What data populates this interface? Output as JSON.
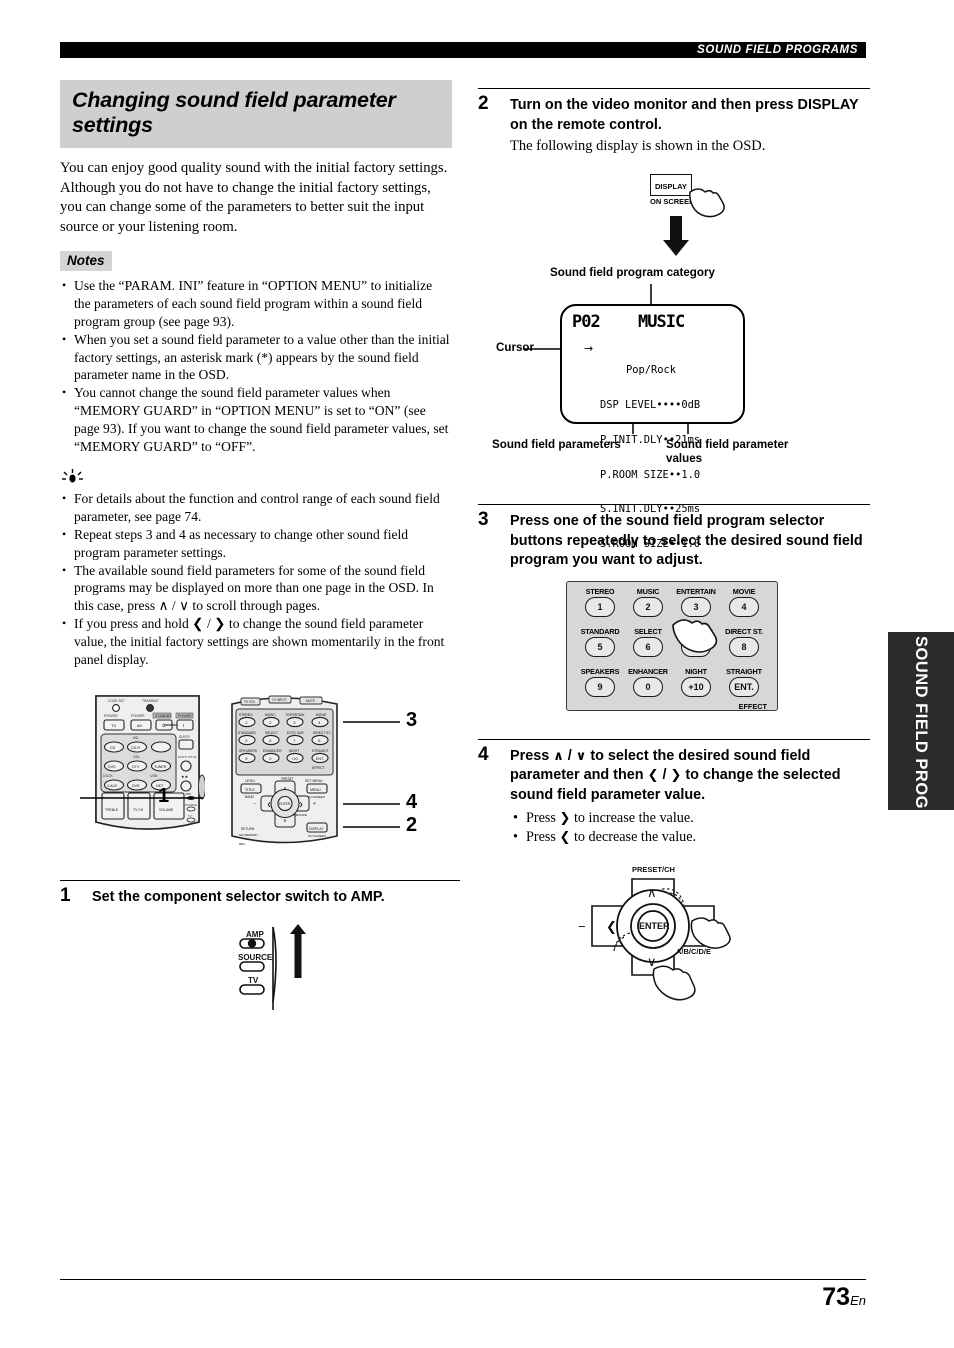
{
  "header": {
    "section_title": "SOUND FIELD PROGRAMS"
  },
  "page": {
    "number": "73",
    "lang_suffix": "En"
  },
  "side_tab": {
    "label": "SOUND FIELD PROGRAMS"
  },
  "title": {
    "text": "Changing sound field parameter settings"
  },
  "intro": {
    "text": "You can enjoy good quality sound with the initial factory settings. Although you do not have to change the initial factory settings, you can change some of the parameters to better suit the input source or your listening room."
  },
  "notes": {
    "label": "Notes",
    "items": [
      "Use the “PARAM. INI” feature in “OPTION MENU” to initialize the parameters of each sound field program within a sound field program group (see page 93).",
      "When you set a sound field parameter to a value other than the initial factory settings, an asterisk mark (*) appears by the sound field parameter name in the OSD.",
      "You cannot change the sound field parameter values when “MEMORY GUARD” in “OPTION MENU” is set to “ON” (see page 93). If you want to change the sound field parameter values, set “MEMORY GUARD” to “OFF”."
    ]
  },
  "tips": {
    "icon": "tip-bulb-icon",
    "items": [
      "For details about the function and control range of each sound field parameter, see page 74.",
      "Repeat steps 3 and 4 as necessary to change other sound field program parameter settings.",
      "The available sound field parameters for some of the sound field programs may be displayed on more than one page in the OSD. In this case, press ∧ / ∨ to scroll through pages.",
      "If you press and hold ❮ / ❯ to change the sound field parameter value, the initial factory settings are shown momentarily in the front panel display."
    ]
  },
  "remote_figure": {
    "callouts": [
      "1",
      "3",
      "4",
      "2"
    ],
    "left_remote": {
      "indicator_labels": [
        "CODE SET",
        "TRANSMIT"
      ],
      "power_labels": [
        "POWER",
        "POWER",
        "STANDBY",
        "POWER"
      ],
      "power_buttons": [
        "TV",
        "AV",
        "⏻",
        "I"
      ],
      "sleep_label": "SLEEP",
      "group_labels": [
        "MD",
        "CBL.",
        "DOCK",
        "USB",
        "MULTI CH IN"
      ],
      "source_buttons": [
        "CD",
        "CD-R",
        "DVD",
        "DTV",
        "TUNER",
        "V.AUX",
        "DVR",
        "NET"
      ],
      "bottom_labels": [
        "TREBLE",
        "TV CH",
        "VOLUME"
      ],
      "switch_labels": [
        "AMP",
        "SOURCE",
        "TV"
      ]
    },
    "right_remote": {
      "top_buttons": [
        "TV VOL",
        "TV INPUT",
        "MUTE"
      ],
      "program_captions": [
        "STEREO",
        "MUSIC",
        "ENTERTAIN",
        "MOVIE",
        "STANDARD",
        "SELECT",
        "EXTD SUR.",
        "DIRECT ST.",
        "SPEAKERS",
        "ENHANCER",
        "NIGHT",
        "STRAIGHT"
      ],
      "program_keys": [
        "1",
        "2",
        "3",
        "4",
        "5",
        "6",
        "7",
        "8",
        "9",
        "0",
        "+10",
        "ENT."
      ],
      "effect_label": "EFFECT",
      "left_column": [
        "LEVEL",
        "TITLE",
        "BAND",
        "RETURN",
        "SW MEMORY"
      ],
      "right_column": [
        "SET MENU",
        "MENU",
        "ON SCREEN",
        "DISPLAY"
      ],
      "cursor_labels": [
        "PRESET/CH",
        "ENTER",
        "A/B/C/D/E",
        "−",
        "+"
      ],
      "rec_label": "REC"
    }
  },
  "step1": {
    "number": "1",
    "heading": "Set the component selector switch to AMP.",
    "switch": {
      "positions": [
        "AMP",
        "SOURCE",
        "TV"
      ],
      "selected": "AMP",
      "arrow": "up-arrow-icon"
    }
  },
  "step2": {
    "number": "2",
    "heading": "Turn on the video monitor and then press DISPLAY on the remote control.",
    "sub": "The following display is shown in the OSD.",
    "button": {
      "top_label": "DISPLAY",
      "bottom_label": "ON SCREEN"
    },
    "arrow": "down-arrow-icon",
    "osd": {
      "callout_top": "Sound field program category",
      "callout_left": "Cursor",
      "callout_bottom_left": "Sound field parameters",
      "callout_bottom_right": "Sound field parameter values",
      "program_number": "P02",
      "category": "MUSIC",
      "cursor_glyph": "→",
      "program_name": "Pop/Rock",
      "parameters": [
        {
          "name": "DSP LEVEL",
          "dots": "••••",
          "value": "0dB"
        },
        {
          "name": "P.INIT.DLY",
          "dots": "••",
          "value": "21ms"
        },
        {
          "name": "P.ROOM SIZE",
          "dots": "••",
          "value": "1.0"
        },
        {
          "name": "S.INIT.DLY",
          "dots": "••",
          "value": "25ms"
        },
        {
          "name": "S.ROOM SIZE",
          "dots": "••",
          "value": "1.0"
        }
      ]
    }
  },
  "step3": {
    "number": "3",
    "heading": "Press one of the sound field program selector buttons repeatedly to select the desired sound field program you want to adjust.",
    "keypad": {
      "rows": [
        [
          {
            "caption": "STEREO",
            "key": "1"
          },
          {
            "caption": "MUSIC",
            "key": "2"
          },
          {
            "caption": "ENTERTAIN",
            "key": "3"
          },
          {
            "caption": "MOVIE",
            "key": "4"
          }
        ],
        [
          {
            "caption": "STANDARD",
            "key": "5"
          },
          {
            "caption": "SELECT",
            "key": "6"
          },
          {
            "caption": "EXTD SUR.",
            "key": "7"
          },
          {
            "caption": "DIRECT ST.",
            "key": "8"
          }
        ],
        [
          {
            "caption": "SPEAKERS",
            "key": "9"
          },
          {
            "caption": "ENHANCER",
            "key": "0"
          },
          {
            "caption": "NIGHT",
            "key": "+10"
          },
          {
            "caption": "STRAIGHT",
            "key": "ENT."
          }
        ]
      ],
      "effect_label": "EFFECT",
      "hand_icon": "pointing-hand-icon"
    }
  },
  "step4": {
    "number": "4",
    "heading_parts": {
      "p1": "Press ",
      "up": "∧",
      "slash1": " / ",
      "down": "∨",
      "p2": " to select the desired sound field parameter and then ",
      "left": "❮",
      "slash2": " / ",
      "right": "❯",
      "p3": " to change the selected sound field parameter value."
    },
    "bullets": [
      {
        "pre": "Press ",
        "glyph": "❯",
        "post": " to increase the value."
      },
      {
        "pre": "Press ",
        "glyph": "❮",
        "post": " to decrease the value."
      }
    ],
    "cursor_pad": {
      "top_label": "PRESET/CH",
      "center_label": "ENTER",
      "right_label": "A/B/C/D/E",
      "minus": "−",
      "plus": "+",
      "up_glyph": "∧",
      "down_glyph": "∨",
      "left_glyph": "❮",
      "right_glyph": "❯",
      "hand_icon": "pointing-hand-icon"
    }
  }
}
